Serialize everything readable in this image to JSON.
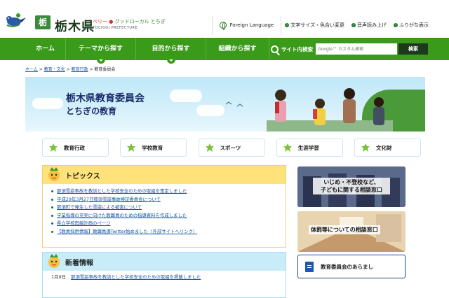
{
  "header": {
    "pref_mark": "栃",
    "site_name": "栃木県",
    "tagline_berry": "ベリー",
    "tagline_rest": "グッドローカル とちぎ",
    "romaji": "TOCHIGI PREFECTURE",
    "foreign_language": "Foreign Language",
    "text_size": "文字サイズ・色合い変更",
    "read_aloud": "音声読み上げ",
    "furigana": "ふりがな表示"
  },
  "nav": {
    "items": [
      "ホーム",
      "テーマから探す",
      "目的から探す",
      "組織から探す"
    ],
    "search_label": "サイト内検索",
    "search_placeholder": "Google™ カスタム検索",
    "search_button": "検索"
  },
  "breadcrumb": {
    "home": "ホーム",
    "education": "教育・文化",
    "admin": "教育行政",
    "current": "教育委員会",
    "sep": " > "
  },
  "hero": {
    "title": "栃木県教育委員会",
    "subtitle": "とちぎの教育"
  },
  "categories": [
    "教育行政",
    "学校教育",
    "スポーツ",
    "生涯学習",
    "文化財"
  ],
  "topics": {
    "heading": "トピックス",
    "items": [
      "那須雪崩事故を教訓とした学校安全のための取組を策定しました",
      "平成29年3月27日那須雪崩事故検証委員会について",
      "那須町で発生した雪崩による被害について",
      "学業指導の充実に向けた教職員のための指導資料を作成しました",
      "県立学校再編計画のページ",
      "【教員採用情報】教職員課Twitter始めました（外部サイトへリンク）"
    ]
  },
  "news": {
    "heading": "新着情報",
    "items": [
      {
        "date": "1月9日",
        "title": "那須雪崩事故を教訓とした学校安全のための取組を掲載しました"
      }
    ]
  },
  "side": {
    "banner1_line1": "いじめ・不登校など、",
    "banner1_line2": "子どもに関する相談窓口",
    "banner2": "体罰等についての相談窓口",
    "about": "教育委員会のあらまし"
  },
  "colors": {
    "nav_green": "#3a9a1a",
    "topics_yellow": "#ffe27a",
    "news_blue": "#c8ecf8",
    "link_blue": "#1a55a8"
  }
}
